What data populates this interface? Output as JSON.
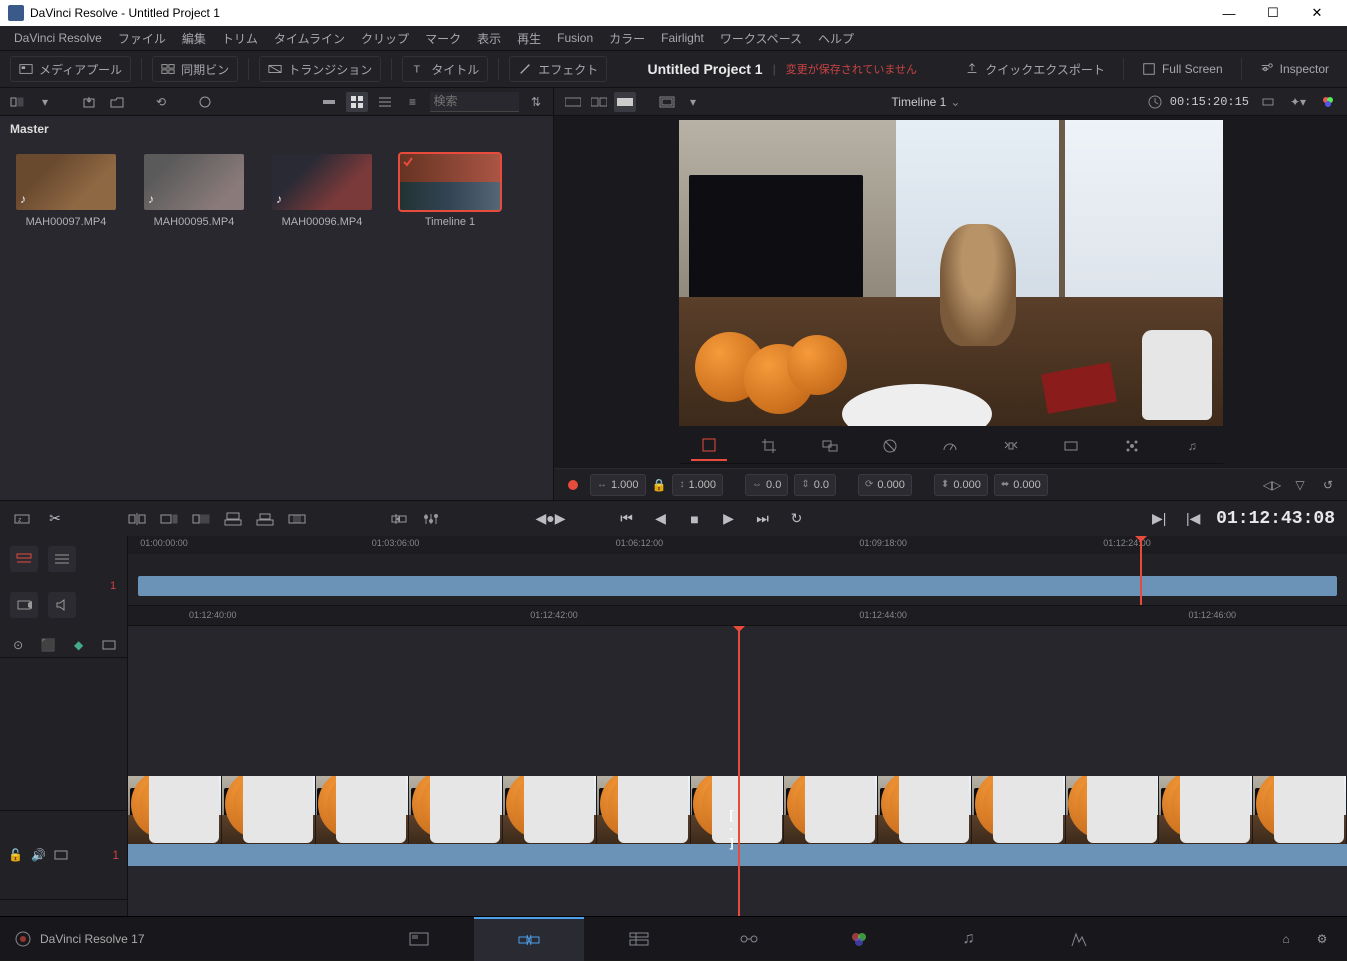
{
  "titlebar": {
    "text": "DaVinci Resolve - Untitled Project 1"
  },
  "menu": [
    "DaVinci Resolve",
    "ファイル",
    "編集",
    "トリム",
    "タイムライン",
    "クリップ",
    "マーク",
    "表示",
    "再生",
    "Fusion",
    "カラー",
    "Fairlight",
    "ワークスペース",
    "ヘルプ"
  ],
  "toolbar": {
    "media_pool": "メディアプール",
    "sync_bin": "同期ビン",
    "transition": "トランジション",
    "title": "タイトル",
    "effect": "エフェクト",
    "project_title": "Untitled Project 1",
    "unsaved": "変更が保存されていません",
    "quick_export": "クイックエクスポート",
    "full_screen": "Full Screen",
    "inspector": "Inspector"
  },
  "media": {
    "search_placeholder": "検索",
    "master": "Master",
    "items": [
      {
        "name": "MAH00097.MP4"
      },
      {
        "name": "MAH00095.MP4"
      },
      {
        "name": "MAH00096.MP4"
      },
      {
        "name": "Timeline 1"
      }
    ]
  },
  "viewer": {
    "timeline_name": "Timeline 1",
    "duration": "00:15:20:15"
  },
  "transform": {
    "zoom_w": "1.000",
    "zoom_h": "1.000",
    "pos_x": "0.0",
    "pos_y": "0.0",
    "rotation": "0.000",
    "pitch": "0.000",
    "yaw": "0.000"
  },
  "playback": {
    "timecode": "01:12:43:08"
  },
  "overview_ruler": [
    {
      "pos": 1,
      "label": "01:00:00:00"
    },
    {
      "pos": 20,
      "label": "01:03:06:00"
    },
    {
      "pos": 40,
      "label": "01:06:12:00"
    },
    {
      "pos": 60,
      "label": "01:09:18:00"
    },
    {
      "pos": 80,
      "label": "01:12:24:00"
    }
  ],
  "detail_ruler": [
    {
      "pos": 5,
      "label": "01:12:40:00"
    },
    {
      "pos": 33,
      "label": "01:12:42:00"
    },
    {
      "pos": 60,
      "label": "01:12:44:00"
    },
    {
      "pos": 87,
      "label": "01:12:46:00"
    }
  ],
  "track": {
    "num": "1",
    "ov_num": "1"
  },
  "bottom": {
    "version": "DaVinci Resolve 17"
  }
}
